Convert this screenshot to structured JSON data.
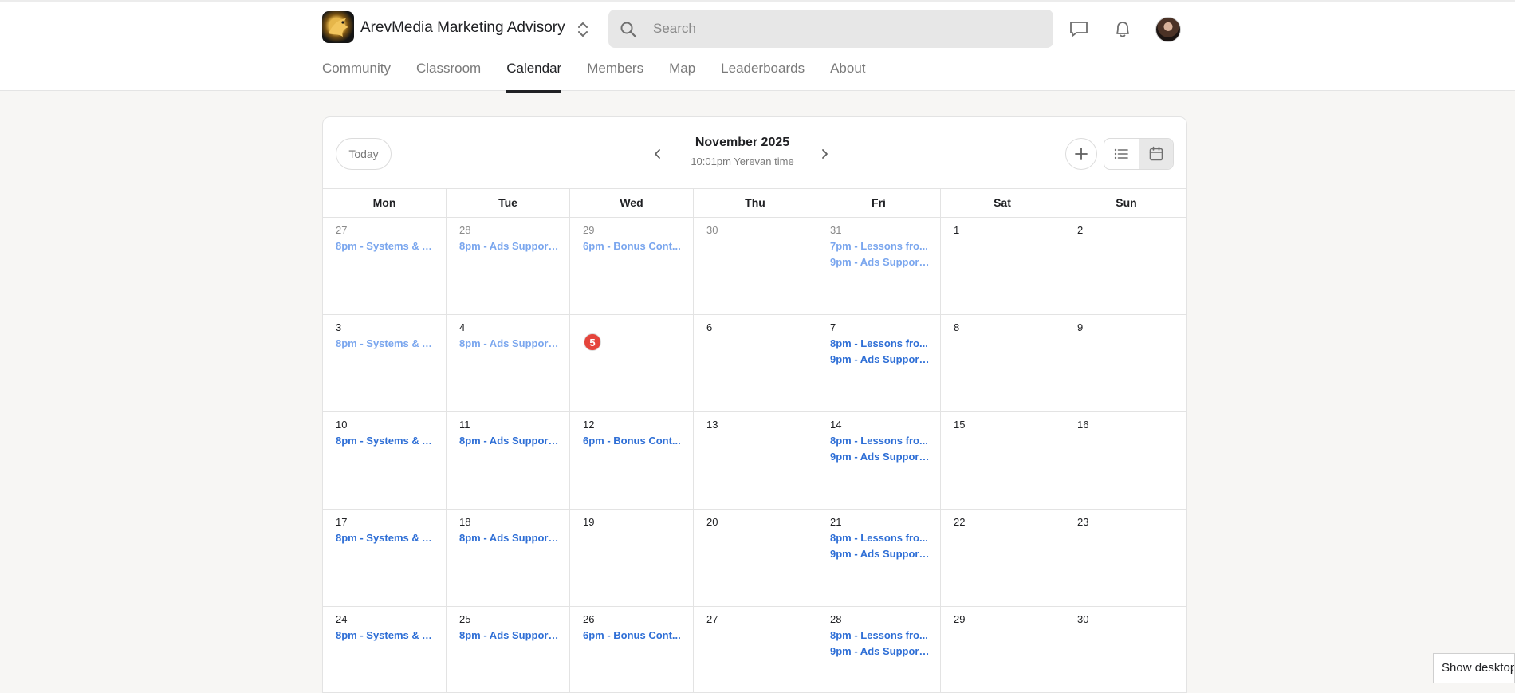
{
  "header": {
    "brand": "ArevMedia Marketing Advisory",
    "search_placeholder": "Search",
    "icons": [
      "switcher-icon",
      "search-icon",
      "chat-icon",
      "bell-icon",
      "avatar"
    ]
  },
  "nav": {
    "tabs": [
      {
        "label": "Community",
        "active": false
      },
      {
        "label": "Classroom",
        "active": false
      },
      {
        "label": "Calendar",
        "active": true
      },
      {
        "label": "Members",
        "active": false
      },
      {
        "label": "Map",
        "active": false
      },
      {
        "label": "Leaderboards",
        "active": false
      },
      {
        "label": "About",
        "active": false
      }
    ]
  },
  "calendar": {
    "today_label": "Today",
    "month": "November 2025",
    "timezone": "10:01pm Yerevan time",
    "weekdays": [
      "Mon",
      "Tue",
      "Wed",
      "Thu",
      "Fri",
      "Sat",
      "Sun"
    ],
    "today_day": "5",
    "colors": {
      "event": "#2f6fd6",
      "past_event": "#7aa6ee",
      "today_badge": "#e5443b"
    },
    "weeks": [
      [
        {
          "day": "27",
          "other": true,
          "events": [
            {
              "text": "8pm - Systems & A...",
              "past": true
            }
          ]
        },
        {
          "day": "28",
          "other": true,
          "events": [
            {
              "text": "8pm - Ads Support...",
              "past": true
            }
          ]
        },
        {
          "day": "29",
          "other": true,
          "events": [
            {
              "text": "6pm - Bonus Cont...",
              "past": true
            }
          ]
        },
        {
          "day": "30",
          "other": true,
          "events": []
        },
        {
          "day": "31",
          "other": true,
          "events": [
            {
              "text": "7pm - Lessons fro...",
              "past": true
            },
            {
              "text": "9pm - Ads Support...",
              "past": true
            }
          ]
        },
        {
          "day": "1",
          "other": false,
          "events": []
        },
        {
          "day": "2",
          "other": false,
          "events": []
        }
      ],
      [
        {
          "day": "3",
          "other": false,
          "events": [
            {
              "text": "8pm - Systems & A...",
              "past": true
            }
          ]
        },
        {
          "day": "4",
          "other": false,
          "events": [
            {
              "text": "8pm - Ads Support...",
              "past": true
            }
          ]
        },
        {
          "day": "5",
          "other": false,
          "today": true,
          "events": []
        },
        {
          "day": "6",
          "other": false,
          "events": []
        },
        {
          "day": "7",
          "other": false,
          "events": [
            {
              "text": "8pm - Lessons fro...",
              "past": false
            },
            {
              "text": "9pm - Ads Support...",
              "past": false
            }
          ]
        },
        {
          "day": "8",
          "other": false,
          "events": []
        },
        {
          "day": "9",
          "other": false,
          "events": []
        }
      ],
      [
        {
          "day": "10",
          "other": false,
          "events": [
            {
              "text": "8pm - Systems & A...",
              "past": false
            }
          ]
        },
        {
          "day": "11",
          "other": false,
          "events": [
            {
              "text": "8pm - Ads Support...",
              "past": false
            }
          ]
        },
        {
          "day": "12",
          "other": false,
          "events": [
            {
              "text": "6pm - Bonus Cont...",
              "past": false
            }
          ]
        },
        {
          "day": "13",
          "other": false,
          "events": []
        },
        {
          "day": "14",
          "other": false,
          "events": [
            {
              "text": "8pm - Lessons fro...",
              "past": false
            },
            {
              "text": "9pm - Ads Support...",
              "past": false
            }
          ]
        },
        {
          "day": "15",
          "other": false,
          "events": []
        },
        {
          "day": "16",
          "other": false,
          "events": []
        }
      ],
      [
        {
          "day": "17",
          "other": false,
          "events": [
            {
              "text": "8pm - Systems & A...",
              "past": false
            }
          ]
        },
        {
          "day": "18",
          "other": false,
          "events": [
            {
              "text": "8pm - Ads Support...",
              "past": false
            }
          ]
        },
        {
          "day": "19",
          "other": false,
          "events": []
        },
        {
          "day": "20",
          "other": false,
          "events": []
        },
        {
          "day": "21",
          "other": false,
          "events": [
            {
              "text": "8pm - Lessons fro...",
              "past": false
            },
            {
              "text": "9pm - Ads Support...",
              "past": false
            }
          ]
        },
        {
          "day": "22",
          "other": false,
          "events": []
        },
        {
          "day": "23",
          "other": false,
          "events": []
        }
      ],
      [
        {
          "day": "24",
          "other": false,
          "events": [
            {
              "text": "8pm - Systems & A...",
              "past": false
            }
          ]
        },
        {
          "day": "25",
          "other": false,
          "events": [
            {
              "text": "8pm - Ads Support...",
              "past": false
            }
          ]
        },
        {
          "day": "26",
          "other": false,
          "events": [
            {
              "text": "6pm - Bonus Cont...",
              "past": false
            }
          ]
        },
        {
          "day": "27",
          "other": false,
          "events": []
        },
        {
          "day": "28",
          "other": false,
          "events": [
            {
              "text": "8pm - Lessons fro...",
              "past": false
            },
            {
              "text": "9pm - Ads Support...",
              "past": false
            }
          ]
        },
        {
          "day": "29",
          "other": false,
          "events": []
        },
        {
          "day": "30",
          "other": false,
          "events": []
        }
      ]
    ]
  },
  "taskbar": {
    "show_desktop": "Show desktop"
  }
}
